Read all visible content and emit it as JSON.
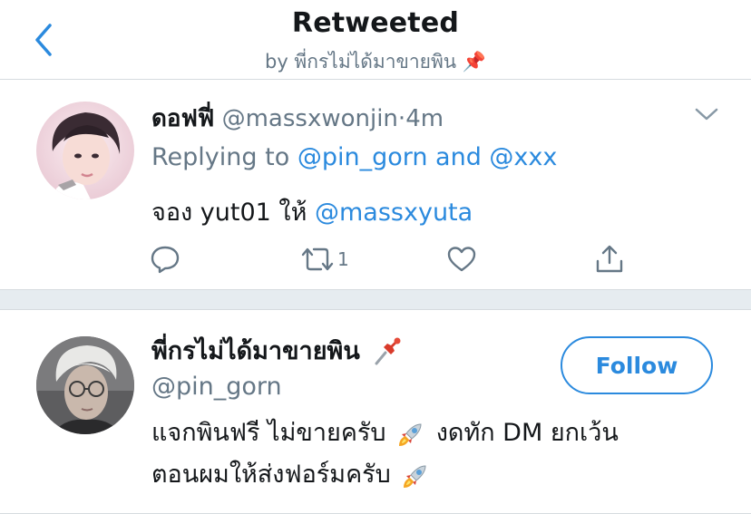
{
  "header": {
    "title": "Retweeted",
    "subtitle": "by พี่กรไม่ได้มาขายพิน 📌"
  },
  "tweet_reply": {
    "name": "ดอฟฟี่",
    "handle": "@massxwonjin",
    "separator": "·",
    "time": "4m",
    "replying_prefix": "Replying to",
    "replying_to": "@pin_gorn and @xxx",
    "text_prefix": "จอง yut01 ให้",
    "mention": "@massxyuta",
    "retweet_count": "1",
    "icons": [
      "reply-icon",
      "retweet-icon",
      "like-icon",
      "share-icon",
      "chevron-down-icon"
    ]
  },
  "tweet_original": {
    "name": "พี่กรไม่ได้มาขายพิน",
    "handle": "@pin_gorn",
    "follow_label": "Follow",
    "line1_a": "แจกพินฟรี ไม่ขายครับ",
    "line1_b": "งดทัก DM ยกเว้น",
    "line2_a": "ตอนผมให้ส่งฟอร์มครับ",
    "icons": [
      "pushpin-icon",
      "rocket-icon"
    ]
  },
  "colors": {
    "link": "#2b8ade",
    "secondary_text": "#657786",
    "divider": "#e6ecf0"
  }
}
